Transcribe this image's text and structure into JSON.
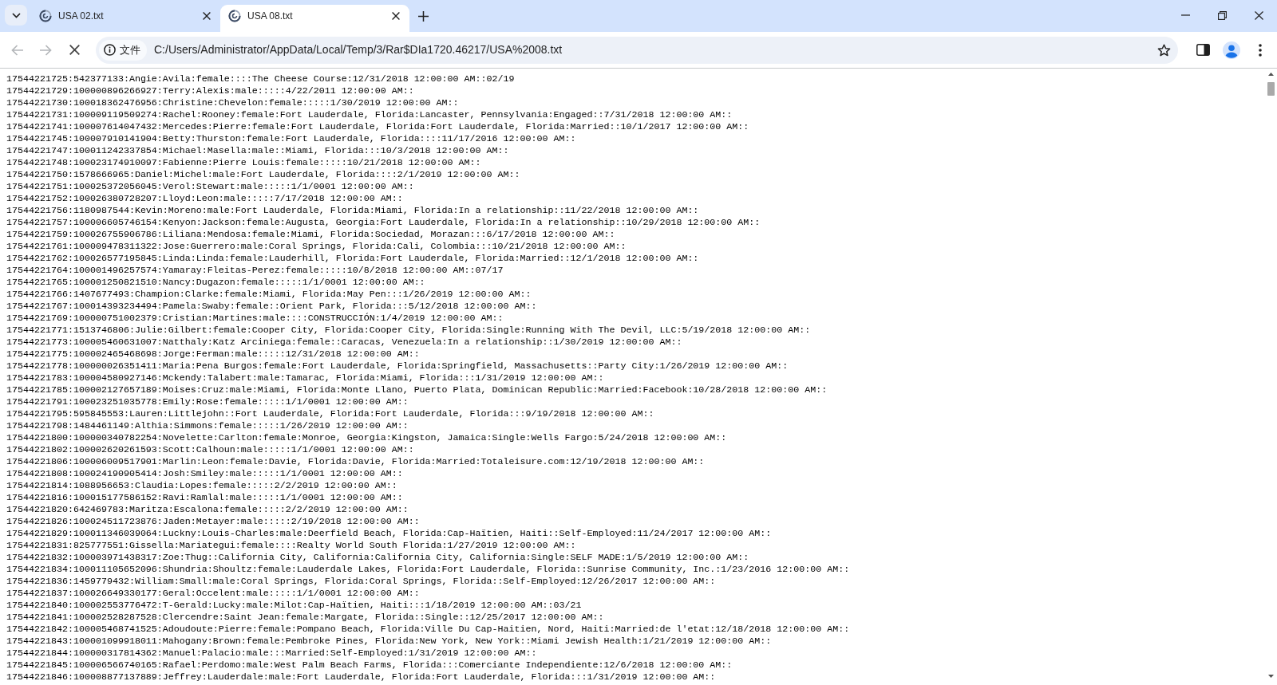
{
  "browser": {
    "tabs": [
      {
        "title": "USA 02.txt",
        "selected": false
      },
      {
        "title": "USA 08.txt",
        "selected": true
      }
    ],
    "address_bar": {
      "site_info": "文件",
      "url": "C:/Users/Administrator/AppData/Local/Temp/3/Rar$DIa1720.46217/USA%2008.txt"
    }
  },
  "document": {
    "lines": [
      "17544221725:542377133:Angie:Avila:female::::The Cheese Course:12/31/2018 12:00:00 AM::02/19",
      "17544221729:100000896266927:Terry:Alexis:male:::::4/22/2011 12:00:00 AM::",
      "17544221730:100018362476956:Christine:Chevelon:female:::::1/30/2019 12:00:00 AM::",
      "17544221731:100009119509274:Rachel:Rooney:female:Fort Lauderdale, Florida:Lancaster, Pennsylvania:Engaged::7/31/2018 12:00:00 AM::",
      "17544221741:100007614047432:Mercedes:Pierre:female:Fort Lauderdale, Florida:Fort Lauderdale, Florida:Married::10/1/2017 12:00:00 AM::",
      "17544221745:100007910141904:Betty:Thurston:female:Fort Lauderdale, Florida::::11/17/2016 12:00:00 AM::",
      "17544221747:100011242337854:Michael:Masella:male::Miami, Florida:::10/3/2018 12:00:00 AM::",
      "17544221748:100023174910097:Fabienne:Pierre Louis:female:::::10/21/2018 12:00:00 AM::",
      "17544221750:1578666965:Daniel:Michel:male:Fort Lauderdale, Florida::::2/1/2019 12:00:00 AM::",
      "17544221751:100025372056045:Verol:Stewart:male:::::1/1/0001 12:00:00 AM::",
      "17544221752:100026380728207:Lloyd:Leon:male:::::7/17/2018 12:00:00 AM::",
      "17544221756:1180987544:Kevin:Moreno:male:Fort Lauderdale, Florida:Miami, Florida:In a relationship::11/22/2018 12:00:00 AM::",
      "17544221757:100006605746154:Kenyon:Jackson:female:Augusta, Georgia:Fort Lauderdale, Florida:In a relationship::10/29/2018 12:00:00 AM::",
      "17544221759:100026755906786:Liliana:Mendosa:female:Miami, Florida:Sociedad, Morazan:::6/17/2018 12:00:00 AM::",
      "17544221761:100009478311322:Jose:Guerrero:male:Coral Springs, Florida:Cali, Colombia:::10/21/2018 12:00:00 AM::",
      "17544221762:100026577195845:Linda:Linda:female:Lauderhill, Florida:Fort Lauderdale, Florida:Married::12/1/2018 12:00:00 AM::",
      "17544221764:100001496257574:Yamaray:Fleitas-Perez:female:::::10/8/2018 12:00:00 AM::07/17",
      "17544221765:100001250821510:Nancy:Dugazon:female:::::1/1/0001 12:00:00 AM::",
      "17544221766:1407677493:Champion:Clarke:female:Miami, Florida:May Pen:::1/26/2019 12:00:00 AM::",
      "17544221767:100014393234494:Pamela:Swaby:female::Orient Park, Florida:::5/12/2018 12:00:00 AM::",
      "17544221769:100000751002379:Cristian:Martines:male::::CONSTRUCCIÓN:1/4/2019 12:00:00 AM::",
      "17544221771:1513746806:Julie:Gilbert:female:Cooper City, Florida:Cooper City, Florida:Single:Running With The Devil, LLC:5/19/2018 12:00:00 AM::",
      "17544221773:100005460631007:Natthaly:Katz Arciniega:female::Caracas, Venezuela:In a relationship::1/30/2019 12:00:00 AM::",
      "17544221775:100002465468698:Jorge:Ferman:male:::::12/31/2018 12:00:00 AM::",
      "17544221778:100000026351411:Maria:Pena Burgos:female:Fort Lauderdale, Florida:Springfield, Massachusetts::Party City:1/26/2019 12:00:00 AM::",
      "17544221783:100004580927146:Mckendy:Talabert:male:Tamarac, Florida:Miami, Florida:::1/31/2019 12:00:00 AM::",
      "17544221785:100002127657189:Moises:Cruz:male:Miami, Florida:Monte Llano, Puerto Plata, Dominican Republic:Married:Facebook:10/28/2018 12:00:00 AM::",
      "17544221791:100023251035778:Emily:Rose:female:::::1/1/0001 12:00:00 AM::",
      "17544221795:595845553:Lauren:Littlejohn::Fort Lauderdale, Florida:Fort Lauderdale, Florida:::9/19/2018 12:00:00 AM::",
      "17544221798:1484461149:Althia:Simmons:female:::::1/26/2019 12:00:00 AM::",
      "17544221800:100000340782254:Novelette:Carlton:female:Monroe, Georgia:Kingston, Jamaica:Single:Wells Fargo:5/24/2018 12:00:00 AM::",
      "17544221802:100002620261593:Scott:Calhoun:male:::::1/1/0001 12:00:00 AM::",
      "17544221806:100006009517901:Marlin:Leon:female:Davie, Florida:Davie, Florida:Married:Totaleisure.com:12/19/2018 12:00:00 AM::",
      "17544221808:100024190905414:Josh:Smiley:male:::::1/1/0001 12:00:00 AM::",
      "17544221814:1088956653:Claudia:Lopes:female:::::2/2/2019 12:00:00 AM::",
      "17544221816:100015177586152:Ravi:Ramlal:male:::::1/1/0001 12:00:00 AM::",
      "17544221820:642469783:Maritza:Escalona:female:::::2/2/2019 12:00:00 AM::",
      "17544221826:100024511723876:Jaden:Metayer:male:::::2/19/2018 12:00:00 AM::",
      "17544221829:100011346039064:Luckny:Louis-Charles:male:Deerfield Beach, Florida:Cap-Haïtien, Haiti::Self-Employed:11/24/2017 12:00:00 AM::",
      "17544221831:825777551:Gissella:Mariategui:female::::Realty World South Florida:1/27/2019 12:00:00 AM::",
      "17544221832:100003971438317:Zoe:Thug::California City, California:California City, California:Single:SELF MADE:1/5/2019 12:00:00 AM::",
      "17544221834:100011105652096:Shundria:Shoultz:female:Lauderdale Lakes, Florida:Fort Lauderdale, Florida::Sunrise Community, Inc.:1/23/2016 12:00:00 AM::",
      "17544221836:1459779432:William:Small:male:Coral Springs, Florida:Coral Springs, Florida::Self-Employed:12/26/2017 12:00:00 AM::",
      "17544221837:100026649330177:Geral:Occelent:male:::::1/1/0001 12:00:00 AM::",
      "17544221840:100002553776472:T-Gerald:Lucky:male:Milot:Cap-Haïtien, Haiti:::1/18/2019 12:00:00 AM::03/21",
      "17544221841:100002528287528:Clercendre:Saint Jean:female:Margate, Florida::Single::12/25/2017 12:00:00 AM::",
      "17544221842:100005468741525:Adoudoute:Pierre:female:Pompano Beach, Florida:Ville Du Cap-Haitien, Nord, Haiti:Married:de l'etat:12/18/2018 12:00:00 AM::",
      "17544221843:100001099918011:Mahogany:Brown:female:Pembroke Pines, Florida:New York, New York::Miami Jewish Health:1/21/2019 12:00:00 AM::",
      "17544221844:100000317814362:Manuel:Palacio:male:::Married:Self-Employed:1/31/2019 12:00:00 AM::",
      "17544221845:100006566740165:Rafael:Perdomo:male:West Palm Beach Farms, Florida:::Comerciante Independiente:12/6/2018 12:00:00 AM::",
      "17544221846:100008877137889:Jeffrey:Lauderdale:male:Fort Lauderdale, Florida:Fort Lauderdale, Florida:::1/31/2019 12:00:00 AM::"
    ]
  }
}
